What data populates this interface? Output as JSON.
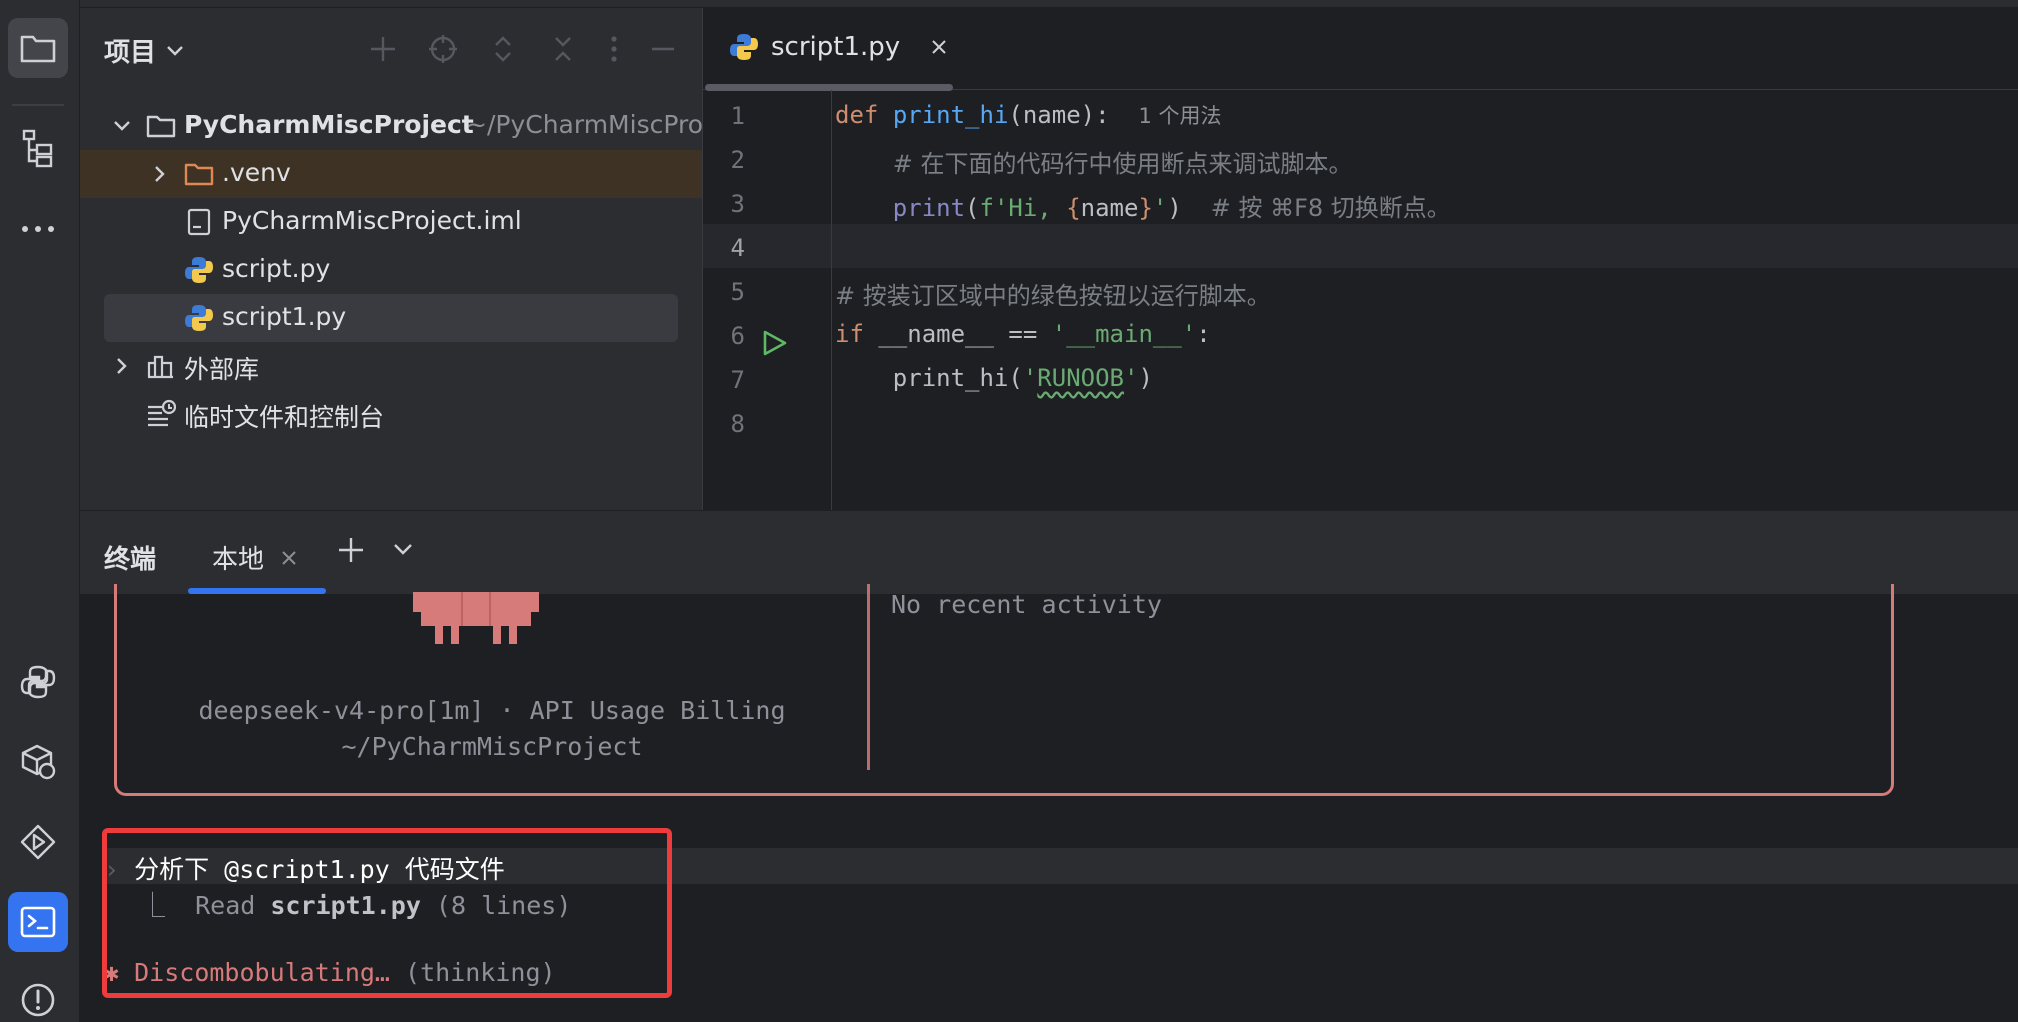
{
  "project": {
    "title": "项目",
    "root_name": "PyCharmMiscProject",
    "root_path": "~/PyCharmMiscProject",
    "items": [
      {
        "label": ".venv"
      },
      {
        "label": "PyCharmMiscProject.iml"
      },
      {
        "label": "script.py"
      },
      {
        "label": "script1.py"
      }
    ],
    "external_libs": "外部库",
    "scratches": "临时文件和控制台"
  },
  "editor": {
    "tab_label": "script1.py",
    "usage_hint": "1 个用法",
    "line_numbers": [
      "1",
      "2",
      "3",
      "4",
      "5",
      "6",
      "7",
      "8"
    ],
    "lines": {
      "l1_def": "def",
      "l1_fn": "print_hi",
      "l1_params": "(name):",
      "l2_comment": "# 在下面的代码行中使用断点来调试脚本。",
      "l3_print": "print",
      "l3_open": "(",
      "l3_fstr_a": "f'Hi, ",
      "l3_brace_open": "{",
      "l3_name": "name",
      "l3_brace_close": "}",
      "l3_fstr_b": "'",
      "l3_close": ")",
      "l3_comment": "# 按 ⌘F8 切换断点。",
      "l5_comment": "# 按装订区域中的绿色按钮以运行脚本。",
      "l6_if": "if",
      "l6_cond": " __name__ == ",
      "l6_str": "'__main__'",
      "l6_colon": ":",
      "l7_call": "print_hi(",
      "l7_q1": "'",
      "l7_arg": "RUNOOB",
      "l7_q2": "'",
      "l7_close": ")"
    }
  },
  "terminal": {
    "title": "终端",
    "tab_label": "本地",
    "model_info": "deepseek-v4-pro[1m] · API Usage Billing",
    "cwd": "~/PyCharmMiscProject",
    "recent": "No recent activity",
    "prompt_caret": "›",
    "prompt_text": " 分析下 @script1.py 代码文件",
    "read_prefix": "⎿  Read ",
    "read_file": "script1.py",
    "read_suffix": " (8 lines)",
    "thinking_star": "✱",
    "thinking_word": " Discombobulating…",
    "thinking_paren": " (thinking)"
  },
  "colors": {
    "accent": "#3574f0",
    "highlight": "#ee3b3b",
    "claude": "#d77a7a"
  }
}
